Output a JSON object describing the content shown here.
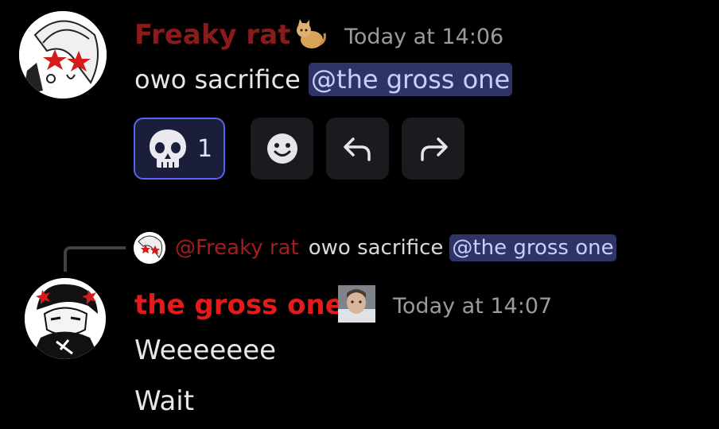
{
  "messages": [
    {
      "author": "Freaky rat",
      "author_color": "#8b1a1a",
      "badge_icon": "cat-emoji-icon",
      "timestamp": "Today at 14:06",
      "text": "owo sacrifice",
      "mention": "@the gross one",
      "reactions": [
        {
          "icon": "skull-icon",
          "count": "1"
        }
      ]
    },
    {
      "author": "the gross one",
      "author_color": "#e31b1b",
      "badge_icon": "profile-photo-icon",
      "timestamp": "Today at 14:07",
      "reply": {
        "author": "@Freaky rat",
        "text": "owo sacrifice",
        "mention": "@the gross one"
      },
      "lines": [
        "Weeeeeee",
        "Wait"
      ]
    }
  ],
  "actions": {
    "add_reaction_icon": "smiley-icon",
    "reply_icon": "reply-arrow-icon",
    "forward_icon": "forward-arrow-icon"
  },
  "colors": {
    "background": "#000000",
    "mention_bg": "#2f3366",
    "mention_text": "#c9cdff",
    "reaction_border": "#5865f2"
  }
}
